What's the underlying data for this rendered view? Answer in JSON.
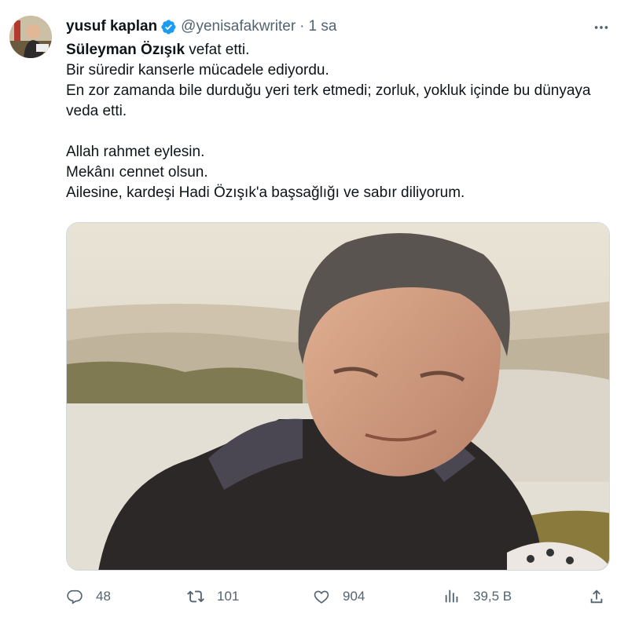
{
  "author": {
    "name": "yusuf kaplan",
    "handle": "@yenisafakwriter",
    "separator": "·",
    "time": "1 sa"
  },
  "tweet": {
    "bold_name": "Süleyman Özışık",
    "first_line_rest": " vefat etti.",
    "lines_a": [
      "Bir süredir kanserle mücadele ediyordu.",
      "En zor zamanda bile durduğu yeri terk etmedi; zorluk, yokluk içinde bu dünyaya veda etti."
    ],
    "lines_b": [
      "Allah rahmet eylesin.",
      "Mekânı cennet olsun.",
      "Ailesine, kardeşi Hadi Özışık'a başsağlığı ve sabır diliyorum."
    ]
  },
  "actions": {
    "replies": "48",
    "reposts": "101",
    "likes": "904",
    "views": "39,5 B"
  },
  "icons": [
    "verified-badge-icon",
    "more-icon",
    "reply-icon",
    "repost-icon",
    "like-icon",
    "views-icon",
    "share-icon"
  ],
  "colors": {
    "verified": "#1d9bf0",
    "muted": "#536471",
    "text": "#0f1419"
  }
}
